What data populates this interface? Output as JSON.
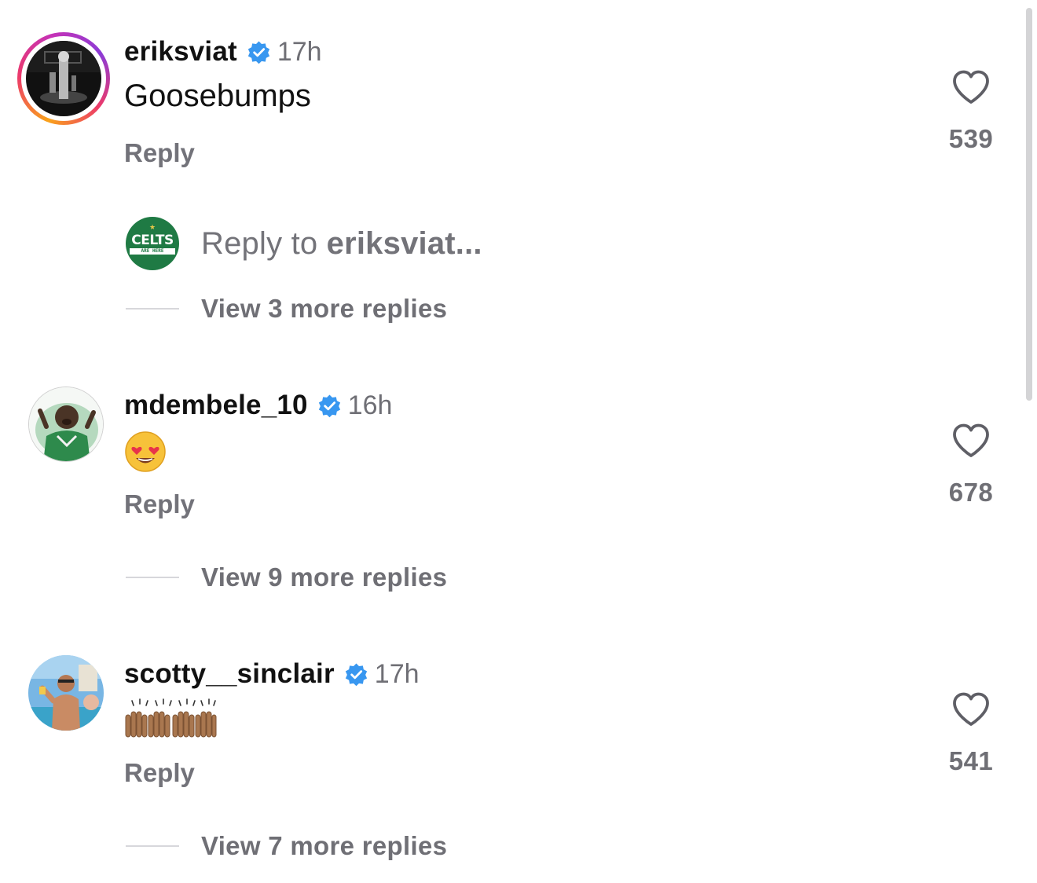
{
  "comments": [
    {
      "username": "eriksviat",
      "verified": true,
      "time": "17h",
      "text": "Goosebumps",
      "reply_label": "Reply",
      "likes": "539",
      "has_story": true,
      "view_replies": "View 3 more replies"
    },
    {
      "username": "mdembele_10",
      "verified": true,
      "time": "16h",
      "text": "😍",
      "reply_label": "Reply",
      "likes": "678",
      "view_replies": "View 9 more replies"
    },
    {
      "username": "scotty__sinclair",
      "verified": true,
      "time": "17h",
      "text": "🙌🏽🙌🏽",
      "reply_label": "Reply",
      "likes": "541",
      "view_replies": "View 7 more replies"
    }
  ],
  "reply_input": {
    "prefix": "Reply to ",
    "target": "eriksviat...",
    "avatar_logo": "CELTS",
    "avatar_logo_sub": "ARE HERE"
  },
  "colors": {
    "verified_blue": "#3897f0",
    "muted_text": "#737379",
    "heart_stroke": "#6f6f75",
    "celts_green": "#1f7a44"
  },
  "icons": {
    "like": "heart-outline-icon",
    "verified": "verified-badge-icon"
  }
}
